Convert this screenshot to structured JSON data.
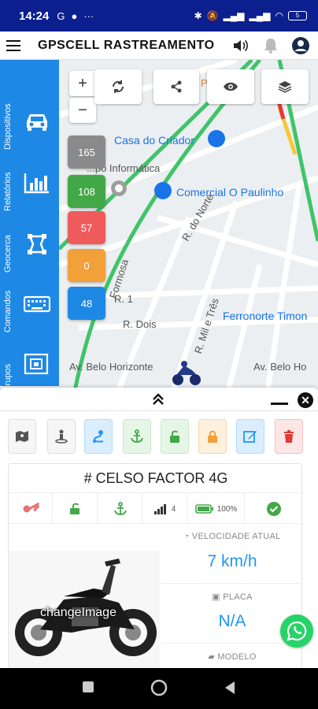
{
  "status_bar": {
    "time": "14:24",
    "battery": "5"
  },
  "app": {
    "title": "GPSCELL RASTREAMENTO"
  },
  "map": {
    "labels": {
      "casa_do_criador": "Casa do Criador",
      "informatica": "...po Informática",
      "comercial": "Comercial O Paulinho",
      "r_do_norte": "R. do Norte",
      "formosa": "Formosa",
      "r1": "R. 1",
      "r_dois": "R. Dois",
      "r_mil_e_tres": "R. Mil e Três",
      "ferronorte": "Ferronorte Timon",
      "belo_horizonte_1": "Av. Belo Horizonte",
      "belo_horizonte_2": "Av. Belo Ho",
      "pa": "Pa"
    },
    "zoom_in": "+",
    "zoom_out": "−"
  },
  "counters": [
    {
      "value": "165",
      "color": "#8a8a8a"
    },
    {
      "value": "108",
      "color": "#43a847"
    },
    {
      "value": "57",
      "color": "#ef5b5b"
    },
    {
      "value": "0",
      "color": "#f2a03a"
    },
    {
      "value": "48",
      "color": "#1e88e5"
    }
  ],
  "sidenav": {
    "items": [
      {
        "label": "Dispositivos",
        "icon": "car-icon"
      },
      {
        "label": "Relatórios",
        "icon": "bar-chart-icon"
      },
      {
        "label": "Geocerca",
        "icon": "polygon-icon"
      },
      {
        "label": "Comandos",
        "icon": "keyboard-icon"
      },
      {
        "label": "Grupos",
        "icon": "group-icon"
      }
    ]
  },
  "device": {
    "name": "# CELSO FACTOR 4G",
    "signal": "4",
    "battery": "100%",
    "photo_caption": "changeImage",
    "speed_label": "VELOCIDADE ATUAL",
    "speed_value": "7 km/h",
    "plate_label": "PLACA",
    "plate_value": "N/A",
    "model_label": "MODELO"
  },
  "colors": {
    "primary": "#1e88e5",
    "statusbar": "#0b1f8f",
    "green": "#43a847",
    "red": "#e53935",
    "orange": "#f2a03a"
  }
}
